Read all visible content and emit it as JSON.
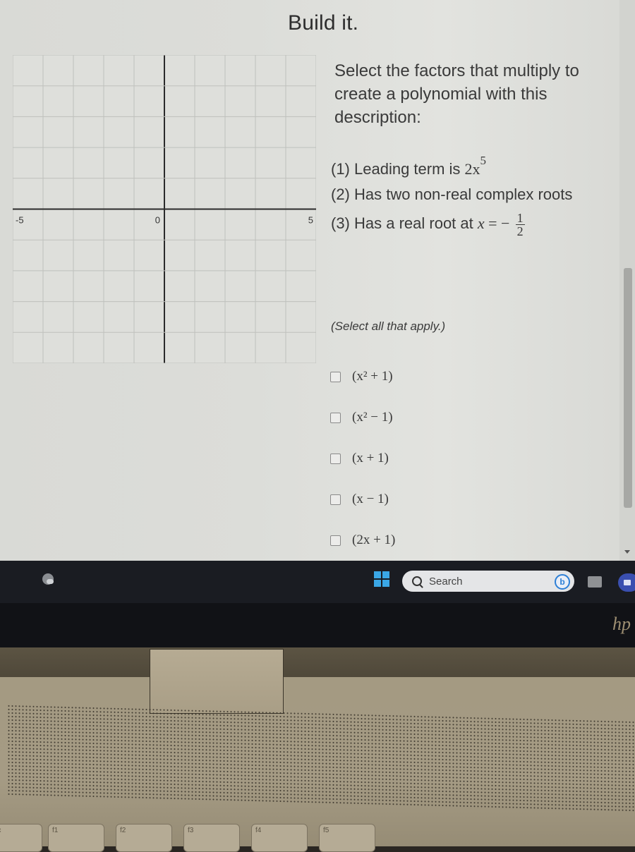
{
  "page": {
    "title": "Build it."
  },
  "graph": {
    "x_axis_labels": [
      "-5",
      "0",
      "5"
    ],
    "x_range": [
      -5,
      5
    ],
    "y_range": [
      -5,
      5
    ],
    "grid_step": 1
  },
  "question": {
    "prompt": "Select the factors that multiply to create a polynomial with this description:",
    "criteria": [
      {
        "prefix": "(1) Leading term is ",
        "math": "2x",
        "exponent": "5"
      },
      {
        "prefix": "(2) Has two non-real complex roots"
      },
      {
        "prefix": "(3) Has a real root at ",
        "math": "x",
        "relation": " = −",
        "frac_num": "1",
        "frac_den": "2"
      }
    ],
    "instruction": "(Select all that apply.)",
    "options": [
      {
        "label": "(x² + 1)",
        "checked": false
      },
      {
        "label": "(x² − 1)",
        "checked": false
      },
      {
        "label": "(x + 1)",
        "checked": false
      },
      {
        "label": "(x − 1)",
        "checked": false
      },
      {
        "label": "(2x + 1)",
        "checked": false
      }
    ]
  },
  "taskbar": {
    "search_placeholder": "Search",
    "bing_glyph": "b",
    "icons": [
      "weather-icon",
      "windows-start-icon",
      "search-icon",
      "bing-chat-icon",
      "task-view-icon",
      "meet-now-icon"
    ]
  },
  "laptop": {
    "brand_logo": "hp",
    "keys": [
      "esc",
      "f1",
      "f2",
      "f3",
      "f4",
      "f5"
    ]
  },
  "colors": {
    "start_blue": "#3aa7e6",
    "bing_blue": "#2d7fd6",
    "meet_blue": "#3a4fb0"
  }
}
